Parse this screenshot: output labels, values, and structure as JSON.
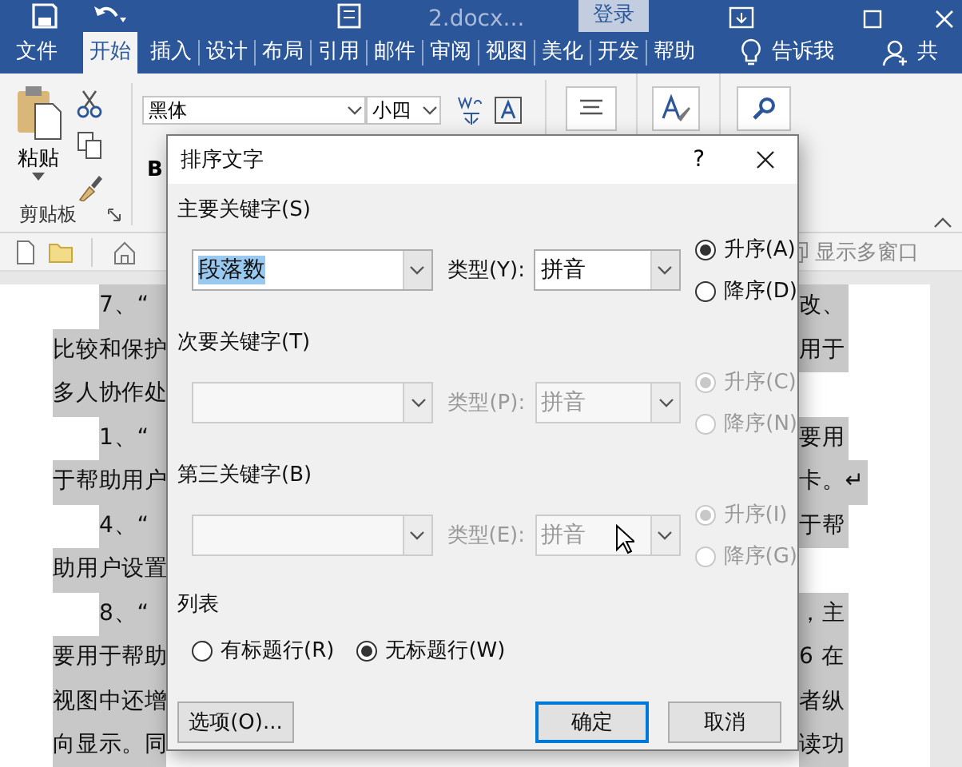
{
  "title_bar": {
    "document_name": "2.docx...",
    "sign_in": "登录"
  },
  "tabs": [
    {
      "label": "文件",
      "selected": false
    },
    {
      "label": "开始",
      "selected": true
    },
    {
      "label": "插入",
      "selected": false
    },
    {
      "label": "设计",
      "selected": false
    },
    {
      "label": "布局",
      "selected": false
    },
    {
      "label": "引用",
      "selected": false
    },
    {
      "label": "邮件",
      "selected": false
    },
    {
      "label": "审阅",
      "selected": false
    },
    {
      "label": "视图",
      "selected": false
    },
    {
      "label": "美化",
      "selected": false
    },
    {
      "label": "开发",
      "selected": false
    },
    {
      "label": "帮助",
      "selected": false
    }
  ],
  "tell_me": "告诉我",
  "share": "共",
  "ribbon": {
    "paste": "粘贴",
    "clipboard_label": "剪贴板",
    "font": "黑体",
    "font_size": "小四",
    "bold": "B"
  },
  "nav_bar": {
    "multi_window": "显示多窗口"
  },
  "document": {
    "lines": [
      {
        "kind": "paragraph-start",
        "left": "7、“",
        "right": "改、"
      },
      {
        "kind": "continuation",
        "left": "比较和保护",
        "right": "用于"
      },
      {
        "kind": "continuation",
        "left": "多人协作处"
      },
      {
        "kind": "paragraph-start",
        "left": "1、“",
        "right": "要用"
      },
      {
        "kind": "continuation",
        "left": "于帮助用户",
        "right": "卡。↵"
      },
      {
        "kind": "paragraph-start",
        "left": "4、“",
        "right": "于帮"
      },
      {
        "kind": "continuation",
        "left": "助用户设置"
      },
      {
        "kind": "paragraph-start",
        "left": "8、“",
        "right": "，主"
      },
      {
        "kind": "continuation",
        "left": "要用于帮助",
        "right": "6 在"
      },
      {
        "kind": "continuation",
        "left": "视图中还增",
        "right": "者纵"
      },
      {
        "kind": "continuation",
        "left": "向显示。同",
        "right": "读功"
      }
    ]
  },
  "dialog": {
    "title": "排序文字",
    "help": "?",
    "keys": [
      {
        "label": "主要关键字(S)",
        "value": "段落数",
        "value_selected": true,
        "type_label": "类型(Y):",
        "type_value": "拼音",
        "disabled": false,
        "orders": [
          {
            "label": "升序(A)",
            "selected": true
          },
          {
            "label": "降序(D)",
            "selected": false
          }
        ]
      },
      {
        "label": "次要关键字(T)",
        "type_label": "类型(P):",
        "type_value": "拼音",
        "disabled": true,
        "orders": [
          {
            "label": "升序(C)",
            "selected": true
          },
          {
            "label": "降序(N)",
            "selected": false
          }
        ]
      },
      {
        "label": "第三关键字(B)",
        "type_label": "类型(E):",
        "type_value": "拼音",
        "disabled": true,
        "orders": [
          {
            "label": "升序(I)",
            "selected": true
          },
          {
            "label": "降序(G)",
            "selected": false
          }
        ]
      }
    ],
    "list": {
      "label": "列表",
      "options": [
        {
          "label": "有标题行(R)",
          "selected": false
        },
        {
          "label": "无标题行(W)",
          "selected": true
        }
      ]
    },
    "buttons": [
      {
        "label": "选项(O)...",
        "kind": "options"
      },
      {
        "label": "确定",
        "kind": "default"
      },
      {
        "label": "取消",
        "kind": "normal"
      }
    ]
  }
}
